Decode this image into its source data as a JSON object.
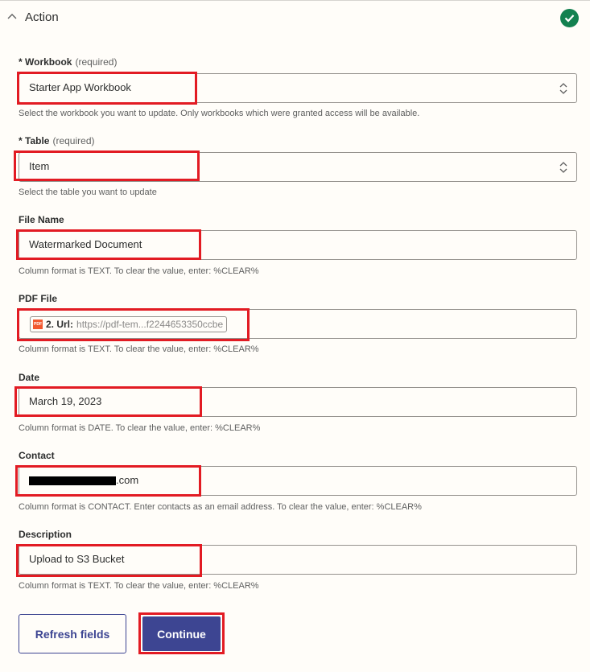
{
  "header": {
    "title": "Action",
    "collapse_icon": "chevron-up-icon",
    "status_icon": "check-circle-icon",
    "status_color": "#138150"
  },
  "fields": {
    "workbook": {
      "label": "* Workbook",
      "required_text": "(required)",
      "value": "Starter App Workbook",
      "hint": "Select the workbook you want to update. Only workbooks which were granted access will be available."
    },
    "table": {
      "label": "* Table",
      "required_text": "(required)",
      "value": "Item",
      "hint": "Select the table you want to update"
    },
    "file_name": {
      "label": "File Name",
      "value": "Watermarked Document",
      "hint": "Column format is TEXT. To clear the value, enter: %CLEAR%"
    },
    "pdf_file": {
      "label": "PDF File",
      "pill_icon": "PDF",
      "pill_key": "2. Url:",
      "pill_value": "https://pdf-tem...f2244653350ccbe",
      "hint": "Column format is TEXT. To clear the value, enter: %CLEAR%"
    },
    "date": {
      "label": "Date",
      "value": "March 19, 2023",
      "hint": "Column format is DATE. To clear the value, enter: %CLEAR%"
    },
    "contact": {
      "label": "Contact",
      "value_suffix": ".com",
      "hint": "Column format is CONTACT. Enter contacts as an email address. To clear the value, enter: %CLEAR%"
    },
    "description": {
      "label": "Description",
      "value": "Upload to S3 Bucket",
      "hint": "Column format is TEXT. To clear the value, enter: %CLEAR%"
    }
  },
  "buttons": {
    "refresh": "Refresh fields",
    "continue": "Continue"
  },
  "colors": {
    "primary": "#3d4592",
    "highlight": "#e21b23",
    "pdf_icon": "#f2582f"
  }
}
